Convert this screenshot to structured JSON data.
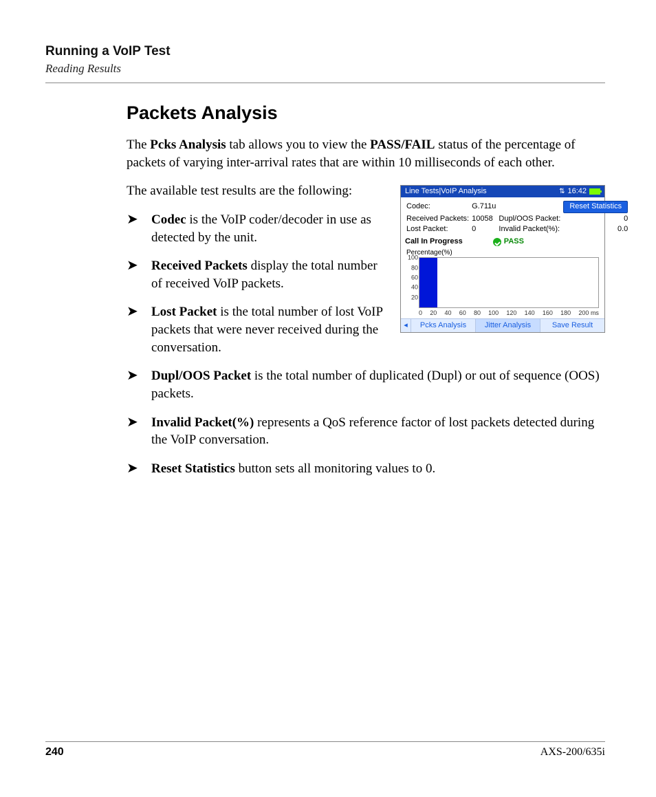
{
  "header": {
    "running_title": "Running a VoIP Test",
    "running_sub": "Reading Results"
  },
  "section": {
    "heading": "Packets Analysis",
    "intro_prefix": "The ",
    "intro_b1": "Pcks Analysis",
    "intro_mid1": " tab allows you to view the ",
    "intro_b2": "PASS/FAIL",
    "intro_suffix": " status of the percentage of packets of varying inter-arrival rates that are within 10 milliseconds of each other.",
    "p2": "The available test results are the following:",
    "bullets": [
      {
        "term": "Codec",
        "rest": " is the VoIP coder/decoder in use as detected by the unit."
      },
      {
        "term": "Received Packets",
        "rest": " display the total number of received VoIP packets."
      },
      {
        "term": "Lost Packet",
        "rest": " is the total number of lost VoIP packets that were never received during the conversation."
      },
      {
        "term": "Dupl/OOS Packet",
        "rest": " is the total number of duplicated (Dupl) or out of sequence (OOS) packets."
      },
      {
        "term": "Invalid Packet(%)",
        "rest": " represents a QoS reference factor of lost packets detected during the VoIP conversation."
      },
      {
        "term": "Reset Statistics",
        "rest": " button sets all monitoring values to 0."
      }
    ]
  },
  "device": {
    "titlebar": {
      "breadcrumb": "Line Tests|VoIP Analysis",
      "time": "16:42"
    },
    "reset_btn": "Reset Statistics",
    "rows": {
      "codec_label": "Codec:",
      "codec_value": "G.711u",
      "received_label": "Received Packets:",
      "received_value": "10058",
      "dupl_label": "Dupl/OOS Packet:",
      "dupl_value": "0",
      "lost_label": "Lost Packet:",
      "lost_value": "0",
      "invalid_label": "Invalid Packet(%):",
      "invalid_value": "0.0"
    },
    "call_label": "Call In Progress",
    "pass_label": "PASS",
    "plot_title": "Percentage(%)",
    "yticks": [
      "100",
      "80",
      "60",
      "40",
      "20"
    ],
    "xticks": [
      "0",
      "20",
      "40",
      "60",
      "80",
      "100",
      "120",
      "140",
      "160",
      "180",
      "200 ms"
    ],
    "footer": {
      "tab1": "Pcks Analysis",
      "tab2": "Jitter Analysis",
      "tab3": "Save Result"
    }
  },
  "chart_data": {
    "type": "bar",
    "title": "Percentage(%)",
    "xlabel": "ms",
    "ylabel": "Percentage(%)",
    "xlim": [
      0,
      200
    ],
    "ylim": [
      0,
      100
    ],
    "x_bins": [
      0,
      20,
      40,
      60,
      80,
      100,
      120,
      140,
      160,
      180,
      200
    ],
    "values": [
      100,
      0,
      0,
      0,
      0,
      0,
      0,
      0,
      0,
      0
    ]
  },
  "footer": {
    "page_no": "240",
    "model": "AXS-200/635i"
  }
}
